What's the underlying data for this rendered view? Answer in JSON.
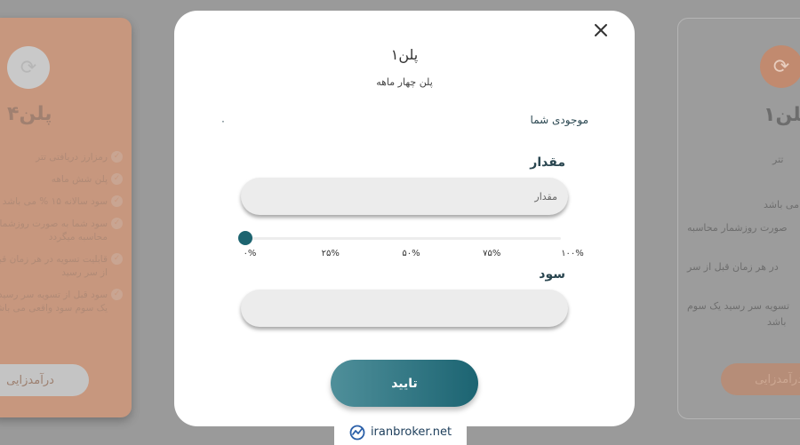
{
  "background": {
    "left_card": {
      "title": "پلن۴",
      "items": [
        "رمزارز دریافتی تتر",
        "پلن شش ماهه",
        "سود سالانه ۱۵ % می باشد",
        "سود شما به صورت روزشمار محاسبه میگردد",
        "قابلیت تسویه در هر زمان قبل از سر رسید",
        "سود قبل از تسویه سر رسید یک سوم سود واقعی می باشد"
      ],
      "button": "درآمدزایی"
    },
    "right_card": {
      "title": "پلن۱",
      "lines": [
        "تتر",
        "می باشد",
        "صورت روزشمار محاسبه",
        "در هر زمان قبل از سر",
        "تسویه سر رسید یک سوم",
        "باشد"
      ],
      "button": "درآمدزایی"
    }
  },
  "modal": {
    "title": "پلن۱",
    "subtitle": "پلن چهار ماهه",
    "balance_label": "موجودی شما",
    "balance_value": "۰",
    "amount_label": "مقدار",
    "amount_placeholder": "مقدار",
    "amount_value": "",
    "slider_value_percent": 0,
    "slider_ticks": [
      "۰%",
      "۲۵%",
      "۵۰%",
      "۷۵%",
      "۱۰۰%"
    ],
    "profit_label": "سود",
    "profit_value": "",
    "confirm_button": "تایید",
    "close_icon": "close-icon"
  },
  "watermark": {
    "text": "iranbroker.net",
    "icon": "iranbroker-logo-icon",
    "color": "#2a5fa8"
  },
  "colors": {
    "accent": "#1d6470",
    "plan_card": "#c7977e"
  }
}
